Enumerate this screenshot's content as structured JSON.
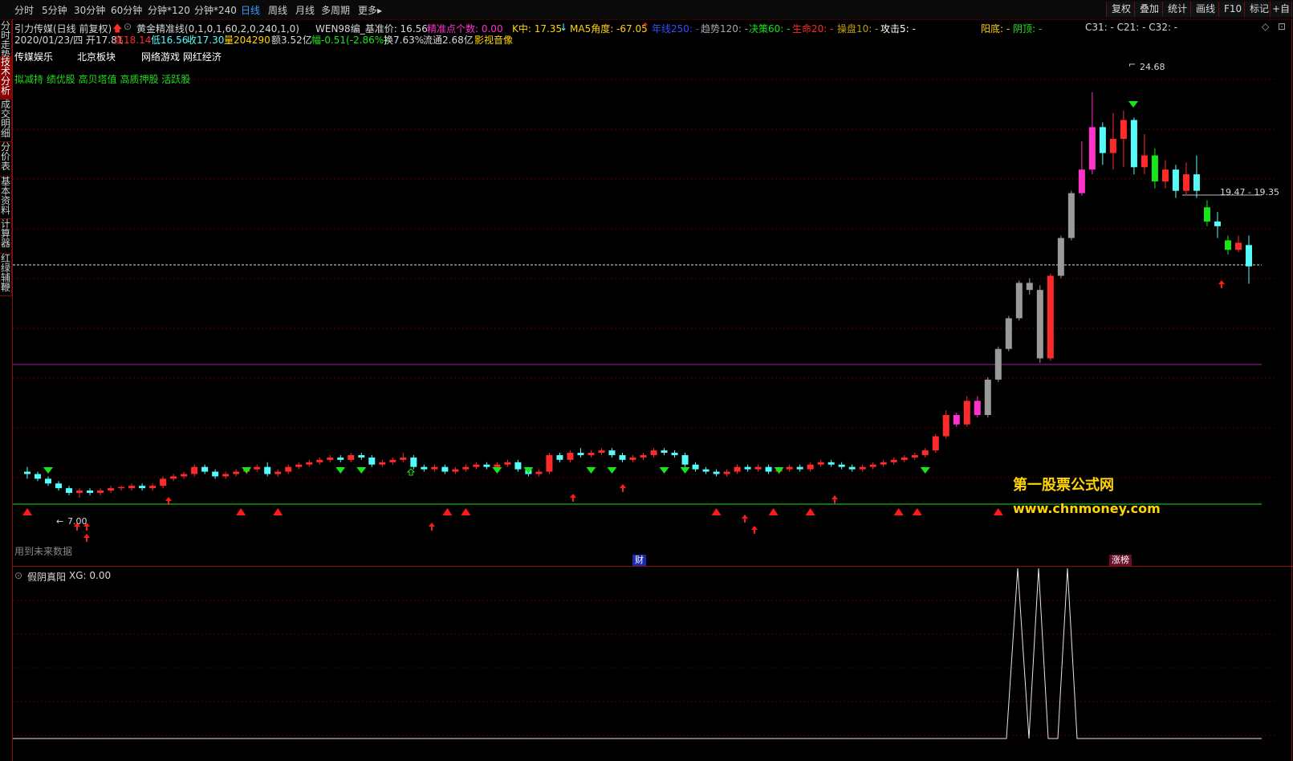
{
  "toolbar": {
    "periods": [
      "分时",
      "5分钟",
      "30分钟",
      "60分钟",
      "分钟*120",
      "分钟*240",
      "日线",
      "周线",
      "月线",
      "多周期",
      "更多"
    ],
    "active_period": "日线",
    "more_arrow": "▸",
    "right_buttons": [
      "复权",
      "叠加",
      "统计",
      "画线",
      "F10",
      "标记",
      "+自"
    ]
  },
  "sidebar": [
    "分时走势",
    "技术分析",
    "成交明细",
    "分价表",
    "基本资料",
    "计算器",
    "红绿辅鞭"
  ],
  "header": {
    "stock_name": "引力传媒(日线 前复权)",
    "formula": "黄金精准线(0,1,0,1,60,2,0,240,1,0)",
    "wen": "WEN98编_基准价: 16.56",
    "precise": "精准点个数: 0.00",
    "kmid": "K中: 17.35",
    "ma5": "MA5角度: -67.05",
    "year_line": "年线250: -",
    "trend": "趋势120: -",
    "decision": "决策60: -",
    "life": "生命20: -",
    "operate": "操盘10: -",
    "attack": "攻击5: -",
    "yangdi": "阳底: -",
    "yinding": "阴顶: -",
    "c_vals": "C31: -   C21: -   C32: -",
    "date_open": "2020/01/23/四 开17.81",
    "high": "高18.14",
    "low": "低16.56",
    "close": "收17.30",
    "volume": "量204290",
    "amount": "额3.52亿",
    "change": "幅-0.51(-2.86%)",
    "turnover": "换7.63%",
    "float": "流通2.68亿",
    "extra": "影视音像"
  },
  "concepts": [
    "传媒娱乐",
    "北京板块",
    "网络游戏 网红经济"
  ],
  "tags_line": "拟减持 绩优股 高贝塔值 高质押股 活跃股",
  "chart_labels": {
    "peak": "24.68",
    "low_mark": "7.00",
    "price_range": "19.47 - 19.35",
    "future_data": "用到未来数据",
    "finance_tag": "财",
    "limit_tag": "涨榜"
  },
  "watermark": {
    "title": "第一股票公式网",
    "url": "www.chnmoney.com"
  },
  "indicator": {
    "name": "假阴真阳",
    "value": "XG: 0.00"
  },
  "colors": {
    "up": "#ff2a2a",
    "down": "#54fcfc",
    "magenta": "#ff33cc",
    "gray": "#9a9a9a",
    "green": "#19e619",
    "purple": "#a020a0",
    "grid": "#5a0000",
    "accent": "#3a9cff"
  },
  "chart_data": {
    "type": "candlestick",
    "y_range": [
      6,
      26
    ],
    "series": [
      {
        "name": "K线",
        "values": [
          [
            8.6,
            8.8,
            8.3,
            8.5
          ],
          [
            8.5,
            8.6,
            8.2,
            8.3
          ],
          [
            8.3,
            8.4,
            8.0,
            8.1
          ],
          [
            8.1,
            8.2,
            7.8,
            7.9
          ],
          [
            7.9,
            8.0,
            7.6,
            7.7
          ],
          [
            7.7,
            7.9,
            7.5,
            7.8
          ],
          [
            7.8,
            7.9,
            7.6,
            7.7
          ],
          [
            7.7,
            7.9,
            7.6,
            7.8
          ],
          [
            7.8,
            8.0,
            7.7,
            7.9
          ],
          [
            7.9,
            8.0,
            7.8,
            7.95
          ],
          [
            7.9,
            8.1,
            7.8,
            8.0
          ],
          [
            8.0,
            8.1,
            7.8,
            7.9
          ],
          [
            7.9,
            8.1,
            7.8,
            8.0
          ],
          [
            8.0,
            8.4,
            7.9,
            8.3
          ],
          [
            8.3,
            8.5,
            8.2,
            8.4
          ],
          [
            8.4,
            8.6,
            8.3,
            8.5
          ],
          [
            8.5,
            8.9,
            8.4,
            8.8
          ],
          [
            8.8,
            8.9,
            8.5,
            8.6
          ],
          [
            8.6,
            8.7,
            8.3,
            8.4
          ],
          [
            8.4,
            8.6,
            8.3,
            8.5
          ],
          [
            8.5,
            8.7,
            8.4,
            8.6
          ],
          [
            8.6,
            8.8,
            8.5,
            8.7
          ],
          [
            8.7,
            8.9,
            8.6,
            8.8
          ],
          [
            8.8,
            9.0,
            8.4,
            8.5
          ],
          [
            8.5,
            8.7,
            8.4,
            8.6
          ],
          [
            8.6,
            8.9,
            8.5,
            8.8
          ],
          [
            8.8,
            9.0,
            8.7,
            8.9
          ],
          [
            8.9,
            9.1,
            8.8,
            9.0
          ],
          [
            9.0,
            9.2,
            8.9,
            9.1
          ],
          [
            9.1,
            9.3,
            9.0,
            9.2
          ],
          [
            9.2,
            9.3,
            9.0,
            9.1
          ],
          [
            9.1,
            9.4,
            9.0,
            9.3
          ],
          [
            9.3,
            9.4,
            9.1,
            9.2
          ],
          [
            9.2,
            9.3,
            8.8,
            8.9
          ],
          [
            8.9,
            9.1,
            8.8,
            9.0
          ],
          [
            9.0,
            9.2,
            8.9,
            9.1
          ],
          [
            9.1,
            9.4,
            9.0,
            9.2
          ],
          [
            9.2,
            9.3,
            8.7,
            8.8
          ],
          [
            8.8,
            8.9,
            8.6,
            8.7
          ],
          [
            8.7,
            8.9,
            8.6,
            8.8
          ],
          [
            8.8,
            8.9,
            8.5,
            8.6
          ],
          [
            8.6,
            8.8,
            8.5,
            8.7
          ],
          [
            8.7,
            8.9,
            8.6,
            8.8
          ],
          [
            8.8,
            9.0,
            8.7,
            8.9
          ],
          [
            8.9,
            9.0,
            8.7,
            8.8
          ],
          [
            8.8,
            9.0,
            8.7,
            8.9
          ],
          [
            8.9,
            9.1,
            8.8,
            9.0
          ],
          [
            9.0,
            9.1,
            8.6,
            8.7
          ],
          [
            8.7,
            8.8,
            8.4,
            8.5
          ],
          [
            8.5,
            8.7,
            8.4,
            8.6
          ],
          [
            8.6,
            9.4,
            8.5,
            9.3
          ],
          [
            9.3,
            9.4,
            9.0,
            9.1
          ],
          [
            9.1,
            9.5,
            9.0,
            9.4
          ],
          [
            9.4,
            9.6,
            9.2,
            9.3
          ],
          [
            9.3,
            9.5,
            9.2,
            9.4
          ],
          [
            9.4,
            9.6,
            9.3,
            9.5
          ],
          [
            9.5,
            9.6,
            9.2,
            9.3
          ],
          [
            9.3,
            9.4,
            9.0,
            9.1
          ],
          [
            9.1,
            9.3,
            9.0,
            9.2
          ],
          [
            9.2,
            9.4,
            9.1,
            9.3
          ],
          [
            9.3,
            9.6,
            9.2,
            9.5
          ],
          [
            9.5,
            9.6,
            9.3,
            9.4
          ],
          [
            9.4,
            9.5,
            9.2,
            9.3
          ],
          [
            9.3,
            9.4,
            8.8,
            8.9
          ],
          [
            8.9,
            9.0,
            8.6,
            8.7
          ],
          [
            8.7,
            8.8,
            8.5,
            8.6
          ],
          [
            8.6,
            8.7,
            8.4,
            8.5
          ],
          [
            8.5,
            8.7,
            8.4,
            8.6
          ],
          [
            8.6,
            8.9,
            8.5,
            8.8
          ],
          [
            8.8,
            8.9,
            8.6,
            8.7
          ],
          [
            8.7,
            8.9,
            8.6,
            8.8
          ],
          [
            8.8,
            8.9,
            8.5,
            8.6
          ],
          [
            8.6,
            8.8,
            8.5,
            8.7
          ],
          [
            8.7,
            8.9,
            8.6,
            8.8
          ],
          [
            8.8,
            8.9,
            8.6,
            8.7
          ],
          [
            8.7,
            9.0,
            8.6,
            8.9
          ],
          [
            8.9,
            9.1,
            8.8,
            9.0
          ],
          [
            9.0,
            9.1,
            8.8,
            8.9
          ],
          [
            8.9,
            9.0,
            8.7,
            8.8
          ],
          [
            8.8,
            8.9,
            8.6,
            8.7
          ],
          [
            8.7,
            8.9,
            8.6,
            8.8
          ],
          [
            8.8,
            9.0,
            8.7,
            8.9
          ],
          [
            8.9,
            9.1,
            8.8,
            9.0
          ],
          [
            9.0,
            9.2,
            8.9,
            9.1
          ],
          [
            9.1,
            9.3,
            9.0,
            9.2
          ],
          [
            9.2,
            9.4,
            9.1,
            9.3
          ],
          [
            9.3,
            9.6,
            9.2,
            9.5
          ],
          [
            9.5,
            10.2,
            9.4,
            10.1
          ],
          [
            10.1,
            11.2,
            10.0,
            11.0
          ],
          [
            11.0,
            11.1,
            10.5,
            10.6
          ],
          [
            10.6,
            11.8,
            10.5,
            11.6
          ],
          [
            11.6,
            11.8,
            10.9,
            11.0
          ],
          [
            11.0,
            12.6,
            10.9,
            12.5
          ],
          [
            12.5,
            13.9,
            12.4,
            13.8
          ],
          [
            13.8,
            15.2,
            13.7,
            15.1
          ],
          [
            15.1,
            16.7,
            15.0,
            16.6
          ],
          [
            16.6,
            16.8,
            16.1,
            16.3
          ],
          [
            16.3,
            16.5,
            13.2,
            13.4
          ],
          [
            13.4,
            17.0,
            13.3,
            16.9
          ],
          [
            16.9,
            18.6,
            16.8,
            18.5
          ],
          [
            18.5,
            20.5,
            18.4,
            20.4
          ],
          [
            20.4,
            22.6,
            20.3,
            21.4
          ],
          [
            21.4,
            24.68,
            21.2,
            23.2
          ],
          [
            23.2,
            23.4,
            21.6,
            22.1
          ],
          [
            22.1,
            23.8,
            21.4,
            22.7
          ],
          [
            22.7,
            23.9,
            21.5,
            23.5
          ],
          [
            23.5,
            23.6,
            21.2,
            21.5
          ],
          [
            21.5,
            22.9,
            21.2,
            22.0
          ],
          [
            22.0,
            22.3,
            20.6,
            20.9
          ],
          [
            20.9,
            21.8,
            20.6,
            21.4
          ],
          [
            21.4,
            21.6,
            20.2,
            20.5
          ],
          [
            20.5,
            21.7,
            20.3,
            21.2
          ],
          [
            21.2,
            22.0,
            20.2,
            20.5
          ],
          [
            19.8,
            20.1,
            19.0,
            19.2
          ],
          [
            19.2,
            19.6,
            18.5,
            19.0
          ],
          [
            18.4,
            18.6,
            17.8,
            18.0
          ],
          [
            18.0,
            18.6,
            17.9,
            18.3
          ],
          [
            18.2,
            18.6,
            16.56,
            17.3
          ]
        ]
      }
    ]
  }
}
